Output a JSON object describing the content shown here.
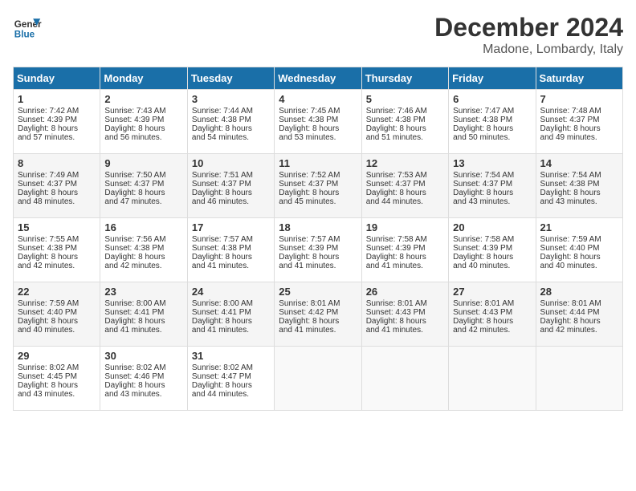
{
  "header": {
    "logo_line1": "General",
    "logo_line2": "Blue",
    "month": "December 2024",
    "location": "Madone, Lombardy, Italy"
  },
  "days_of_week": [
    "Sunday",
    "Monday",
    "Tuesday",
    "Wednesday",
    "Thursday",
    "Friday",
    "Saturday"
  ],
  "weeks": [
    [
      {
        "day": "1",
        "lines": [
          "Sunrise: 7:42 AM",
          "Sunset: 4:39 PM",
          "Daylight: 8 hours",
          "and 57 minutes."
        ]
      },
      {
        "day": "2",
        "lines": [
          "Sunrise: 7:43 AM",
          "Sunset: 4:39 PM",
          "Daylight: 8 hours",
          "and 56 minutes."
        ]
      },
      {
        "day": "3",
        "lines": [
          "Sunrise: 7:44 AM",
          "Sunset: 4:38 PM",
          "Daylight: 8 hours",
          "and 54 minutes."
        ]
      },
      {
        "day": "4",
        "lines": [
          "Sunrise: 7:45 AM",
          "Sunset: 4:38 PM",
          "Daylight: 8 hours",
          "and 53 minutes."
        ]
      },
      {
        "day": "5",
        "lines": [
          "Sunrise: 7:46 AM",
          "Sunset: 4:38 PM",
          "Daylight: 8 hours",
          "and 51 minutes."
        ]
      },
      {
        "day": "6",
        "lines": [
          "Sunrise: 7:47 AM",
          "Sunset: 4:38 PM",
          "Daylight: 8 hours",
          "and 50 minutes."
        ]
      },
      {
        "day": "7",
        "lines": [
          "Sunrise: 7:48 AM",
          "Sunset: 4:37 PM",
          "Daylight: 8 hours",
          "and 49 minutes."
        ]
      }
    ],
    [
      {
        "day": "8",
        "lines": [
          "Sunrise: 7:49 AM",
          "Sunset: 4:37 PM",
          "Daylight: 8 hours",
          "and 48 minutes."
        ]
      },
      {
        "day": "9",
        "lines": [
          "Sunrise: 7:50 AM",
          "Sunset: 4:37 PM",
          "Daylight: 8 hours",
          "and 47 minutes."
        ]
      },
      {
        "day": "10",
        "lines": [
          "Sunrise: 7:51 AM",
          "Sunset: 4:37 PM",
          "Daylight: 8 hours",
          "and 46 minutes."
        ]
      },
      {
        "day": "11",
        "lines": [
          "Sunrise: 7:52 AM",
          "Sunset: 4:37 PM",
          "Daylight: 8 hours",
          "and 45 minutes."
        ]
      },
      {
        "day": "12",
        "lines": [
          "Sunrise: 7:53 AM",
          "Sunset: 4:37 PM",
          "Daylight: 8 hours",
          "and 44 minutes."
        ]
      },
      {
        "day": "13",
        "lines": [
          "Sunrise: 7:54 AM",
          "Sunset: 4:37 PM",
          "Daylight: 8 hours",
          "and 43 minutes."
        ]
      },
      {
        "day": "14",
        "lines": [
          "Sunrise: 7:54 AM",
          "Sunset: 4:38 PM",
          "Daylight: 8 hours",
          "and 43 minutes."
        ]
      }
    ],
    [
      {
        "day": "15",
        "lines": [
          "Sunrise: 7:55 AM",
          "Sunset: 4:38 PM",
          "Daylight: 8 hours",
          "and 42 minutes."
        ]
      },
      {
        "day": "16",
        "lines": [
          "Sunrise: 7:56 AM",
          "Sunset: 4:38 PM",
          "Daylight: 8 hours",
          "and 42 minutes."
        ]
      },
      {
        "day": "17",
        "lines": [
          "Sunrise: 7:57 AM",
          "Sunset: 4:38 PM",
          "Daylight: 8 hours",
          "and 41 minutes."
        ]
      },
      {
        "day": "18",
        "lines": [
          "Sunrise: 7:57 AM",
          "Sunset: 4:39 PM",
          "Daylight: 8 hours",
          "and 41 minutes."
        ]
      },
      {
        "day": "19",
        "lines": [
          "Sunrise: 7:58 AM",
          "Sunset: 4:39 PM",
          "Daylight: 8 hours",
          "and 41 minutes."
        ]
      },
      {
        "day": "20",
        "lines": [
          "Sunrise: 7:58 AM",
          "Sunset: 4:39 PM",
          "Daylight: 8 hours",
          "and 40 minutes."
        ]
      },
      {
        "day": "21",
        "lines": [
          "Sunrise: 7:59 AM",
          "Sunset: 4:40 PM",
          "Daylight: 8 hours",
          "and 40 minutes."
        ]
      }
    ],
    [
      {
        "day": "22",
        "lines": [
          "Sunrise: 7:59 AM",
          "Sunset: 4:40 PM",
          "Daylight: 8 hours",
          "and 40 minutes."
        ]
      },
      {
        "day": "23",
        "lines": [
          "Sunrise: 8:00 AM",
          "Sunset: 4:41 PM",
          "Daylight: 8 hours",
          "and 41 minutes."
        ]
      },
      {
        "day": "24",
        "lines": [
          "Sunrise: 8:00 AM",
          "Sunset: 4:41 PM",
          "Daylight: 8 hours",
          "and 41 minutes."
        ]
      },
      {
        "day": "25",
        "lines": [
          "Sunrise: 8:01 AM",
          "Sunset: 4:42 PM",
          "Daylight: 8 hours",
          "and 41 minutes."
        ]
      },
      {
        "day": "26",
        "lines": [
          "Sunrise: 8:01 AM",
          "Sunset: 4:43 PM",
          "Daylight: 8 hours",
          "and 41 minutes."
        ]
      },
      {
        "day": "27",
        "lines": [
          "Sunrise: 8:01 AM",
          "Sunset: 4:43 PM",
          "Daylight: 8 hours",
          "and 42 minutes."
        ]
      },
      {
        "day": "28",
        "lines": [
          "Sunrise: 8:01 AM",
          "Sunset: 4:44 PM",
          "Daylight: 8 hours",
          "and 42 minutes."
        ]
      }
    ],
    [
      {
        "day": "29",
        "lines": [
          "Sunrise: 8:02 AM",
          "Sunset: 4:45 PM",
          "Daylight: 8 hours",
          "and 43 minutes."
        ]
      },
      {
        "day": "30",
        "lines": [
          "Sunrise: 8:02 AM",
          "Sunset: 4:46 PM",
          "Daylight: 8 hours",
          "and 43 minutes."
        ]
      },
      {
        "day": "31",
        "lines": [
          "Sunrise: 8:02 AM",
          "Sunset: 4:47 PM",
          "Daylight: 8 hours",
          "and 44 minutes."
        ]
      },
      null,
      null,
      null,
      null
    ]
  ]
}
